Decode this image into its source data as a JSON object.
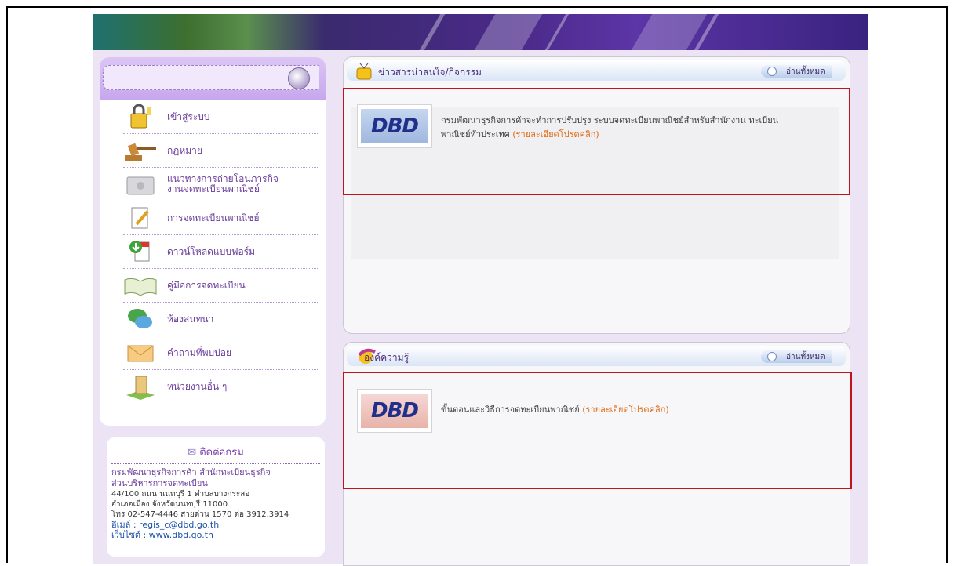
{
  "menu": {
    "items": [
      {
        "label": "เข้าสู่ระบบ",
        "icon": "lock-icon"
      },
      {
        "label": "กฎหมาย",
        "icon": "gavel-icon"
      },
      {
        "label": "แนวทางการถ่ายโอนภารกิจงานจดทะเบียนพาณิชย์",
        "line1": "แนวทางการถ่ายโอนภารกิจ",
        "line2": "งานจดทะเบียนพาณิชย์",
        "icon": "folder-gear-icon"
      },
      {
        "label": "การจดทะเบียนพาณิชย์",
        "icon": "document-edit-icon"
      },
      {
        "label": "ดาวน์โหลดแบบฟอร์ม",
        "icon": "download-icon"
      },
      {
        "label": "คู่มือการจดทะเบียน",
        "icon": "book-icon"
      },
      {
        "label": "ห้องสนทนา",
        "icon": "chat-icon"
      },
      {
        "label": "คำถามที่พบบ่อย",
        "icon": "envelope-icon"
      },
      {
        "label": "หน่วยงานอื่น ๆ",
        "icon": "building-icon"
      }
    ]
  },
  "contact": {
    "title": "ติดต่อกรม",
    "icon": "mail-icon",
    "org_line1": "กรมพัฒนาธุรกิจการค้า สำนักทะเบียนธุรกิจ",
    "org_line2": "ส่วนบริหารการจดทะเบียน",
    "addr_line1": "44/100 ถนน นนทบุรี 1 ตำบลบางกระสอ",
    "addr_line2": "อำเภอเมือง จังหวัดนนทบุรี 11000",
    "phone": "โทร 02-547-4446 สายด่วน 1570 ต่อ 3912,3914",
    "email": "อีเมล์ : regis_c@dbd.go.th",
    "website": "เว็บไซต์ : www.dbd.go.th"
  },
  "news": {
    "title": "ข่าวสารน่าสนใจ/กิจกรรม",
    "icon": "tv-icon",
    "read_all": "อ่านทั้งหมด",
    "item": {
      "logo": "DBD",
      "text_line1": "กรมพัฒนาธุรกิจการค้าจะทำการปรับปรุง ระบบจดทะเบียนพาณิชย์สำหรับสำนักงาน ทะเบียน",
      "text_line2": "พาณิชย์ทั่วประเทศ",
      "more": "(รายละเอียดโปรดคลิก)"
    }
  },
  "knowledge": {
    "title": "องค์ความรู้",
    "icon": "lightbulb-icon",
    "read_all": "อ่านทั้งหมด",
    "item": {
      "logo": "DBD",
      "text": "ขั้นตอนและวิธีการจดทะเบียนพาณิชย์",
      "more": "(รายละเอียดโปรดคลิก)"
    }
  }
}
